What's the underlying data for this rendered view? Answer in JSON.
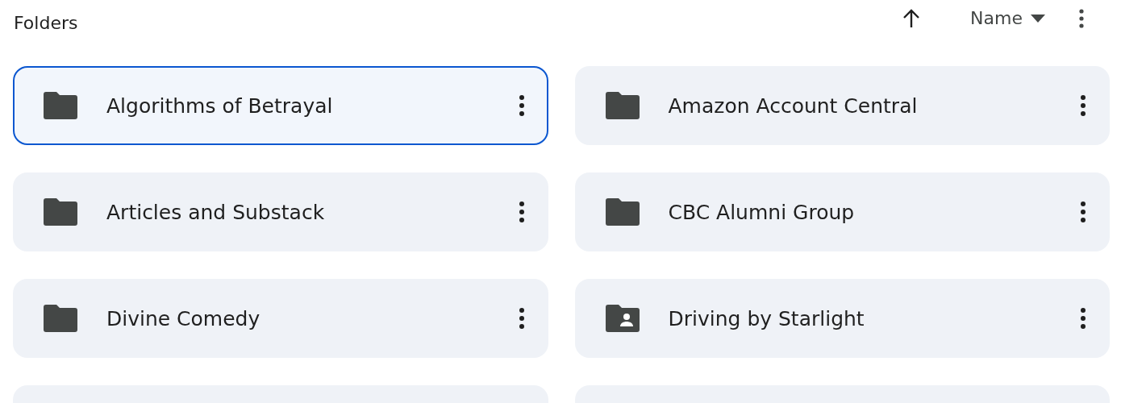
{
  "section_title": "Folders",
  "sort": {
    "ascending": true,
    "label": "Name"
  },
  "folders": [
    {
      "kind": "folder",
      "name": "Algorithms of Betrayal",
      "selected": true
    },
    {
      "kind": "folder",
      "name": "Amazon Account Central",
      "selected": false
    },
    {
      "kind": "folder",
      "name": "Articles and Substack",
      "selected": false
    },
    {
      "kind": "folder",
      "name": "CBC Alumni Group",
      "selected": false
    },
    {
      "kind": "folder",
      "name": "Divine Comedy",
      "selected": false
    },
    {
      "kind": "shared",
      "name": "Driving by Starlight",
      "selected": false
    },
    {
      "kind": "clipped",
      "selected": false
    },
    {
      "kind": "clipped",
      "selected": false
    }
  ]
}
